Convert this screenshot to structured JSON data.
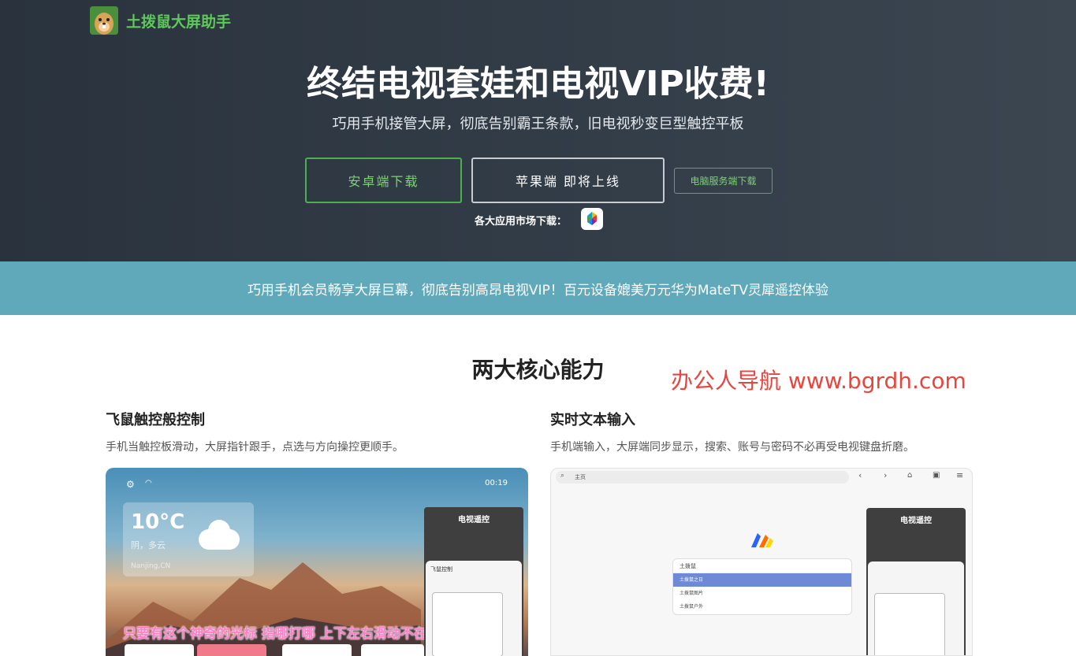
{
  "brand": {
    "name": "土拨鼠大屏助手",
    "color": "#5ec85a"
  },
  "hero": {
    "title": "终结电视套娃和电视VIP收费!",
    "subtitle": "巧用手机接管大屏，彻底告别霸王条款，旧电视秒变巨型触控平板",
    "buttons": {
      "android": "安卓端下载",
      "apple": "苹果端 即将上线",
      "pc": "电脑服务端下载"
    },
    "market_label": "各大应用市场下载："
  },
  "banner": {
    "text": "巧用手机会员畅享大屏巨幕，彻底告别高昂电视VIP！百元设备媲美万元华为MateTV灵犀遥控体验"
  },
  "section": {
    "title": "两大核心能力"
  },
  "watermark": "办公人导航 www.bgrdh.com",
  "features": [
    {
      "title": "飞鼠触控般控制",
      "desc": "手机当触控板滑动，大屏指针跟手，点选与方向操控更顺手。",
      "screen": {
        "temperature": "10°C",
        "weather": "阴，多云",
        "location": "Nanjing,CN",
        "time": "00:19",
        "subtitle": "只要有这个神奇的光标 指哪打哪 上下左右滑动不在话下",
        "phone_title": "电视遥控",
        "phone_card_title": "飞鼠控制"
      }
    },
    {
      "title": "实时文本输入",
      "desc": "手机端输入，大屏端同步显示，搜索、账号与密码不必再受电视键盘折磨。",
      "screen": {
        "browser_address": "主页",
        "search_text": "土拨鼠",
        "suggestions": [
          "土拨鼠之日",
          "土拨鼠图片",
          "土拨鼠户外"
        ],
        "phone_title": "电视遥控"
      }
    }
  ]
}
